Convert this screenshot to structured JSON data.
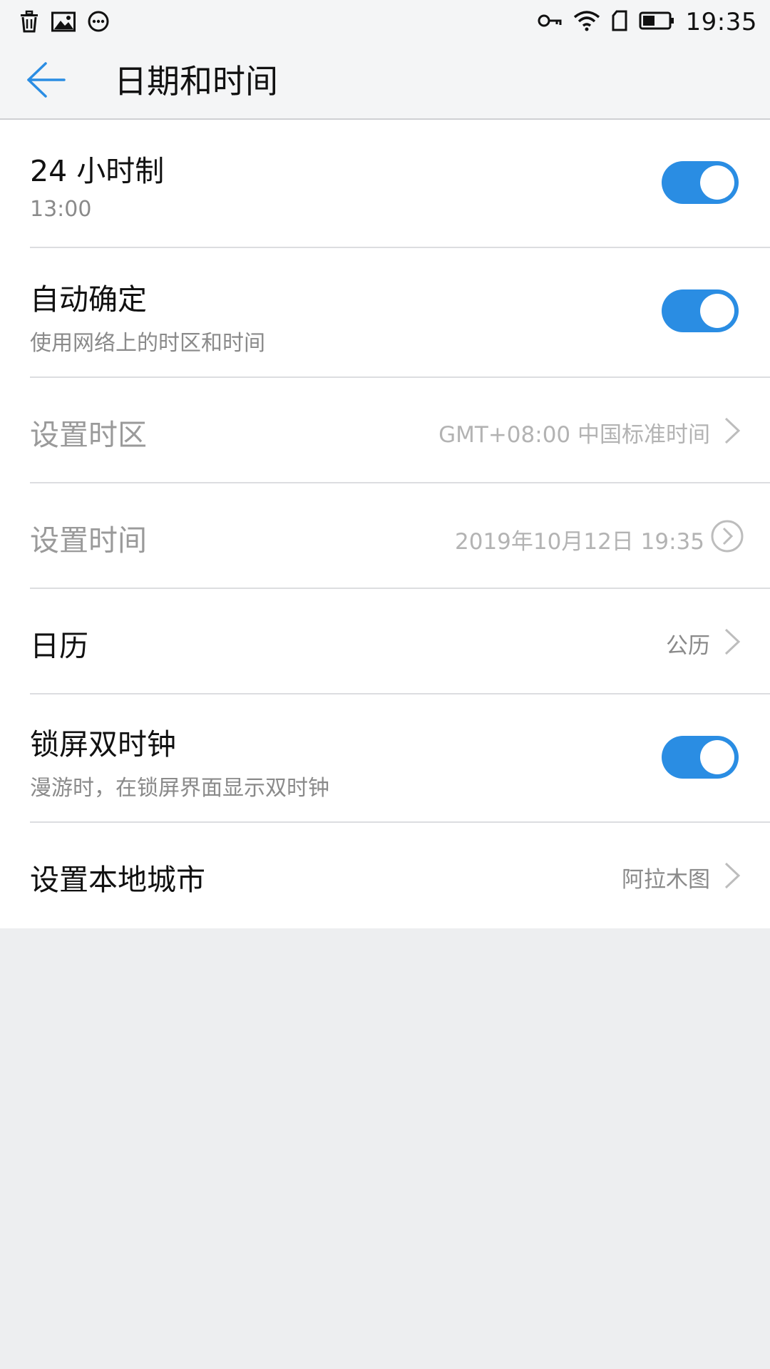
{
  "status_bar": {
    "time": "19:35",
    "left_icons": [
      "trash-icon",
      "image-icon",
      "message-icon"
    ],
    "right_icons": [
      "key-icon",
      "wifi-icon",
      "sim-card-icon",
      "battery-icon"
    ]
  },
  "header": {
    "title": "日期和时间",
    "back_icon": "arrow-left-icon"
  },
  "settings": {
    "hour24": {
      "title": "24 小时制",
      "subtitle": "13:00",
      "enabled": true
    },
    "auto": {
      "title": "自动确定",
      "subtitle": "使用网络上的时区和时间",
      "enabled": true
    },
    "timezone": {
      "title": "设置时区",
      "value": "GMT+08:00 中国标准时间"
    },
    "time": {
      "title": "设置时间",
      "value": "2019年10月12日 19:35"
    },
    "calendar": {
      "title": "日历",
      "value": "公历"
    },
    "dual_clock": {
      "title": "锁屏双时钟",
      "subtitle": "漫游时，在锁屏界面显示双时钟",
      "enabled": true
    },
    "local_city": {
      "title": "设置本地城市",
      "value": "阿拉木图"
    }
  },
  "colors": {
    "accent": "#2a8de3",
    "background": "#edeef0",
    "divider": "#dcdde0"
  }
}
